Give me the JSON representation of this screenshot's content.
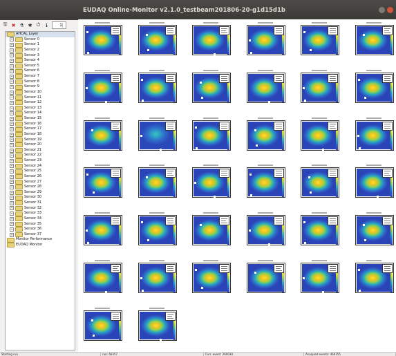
{
  "window": {
    "title": "EUDAQ Online-Monitor v2.1.0_testbeam201806-20-g1d15d1b"
  },
  "toolbar": {
    "icons": [
      "save-icon",
      "close-x-icon",
      "filter-icon",
      "broom-icon",
      "power-icon",
      "info-icon"
    ],
    "spin_value": "1"
  },
  "tree": {
    "root": "AHCAL Layer",
    "sensors": [
      "Sensor 0",
      "Sensor 1",
      "Sensor 2",
      "Sensor 3",
      "Sensor 4",
      "Sensor 5",
      "Sensor 6",
      "Sensor 7",
      "Sensor 8",
      "Sensor 9",
      "Sensor 10",
      "Sensor 11",
      "Sensor 12",
      "Sensor 13",
      "Sensor 14",
      "Sensor 15",
      "Sensor 16",
      "Sensor 17",
      "Sensor 18",
      "Sensor 19",
      "Sensor 20",
      "Sensor 21",
      "Sensor 22",
      "Sensor 23",
      "Sensor 24",
      "Sensor 25",
      "Sensor 26",
      "Sensor 27",
      "Sensor 28",
      "Sensor 29",
      "Sensor 30",
      "Sensor 31",
      "Sensor 32",
      "Sensor 33",
      "Sensor 34",
      "Sensor 35",
      "Sensor 36",
      "Sensor 37"
    ],
    "extra": [
      "Monitor Performance",
      "EUDAQ Monitor"
    ]
  },
  "canvas": {
    "histogram_count": 38,
    "cold_index": 13
  },
  "status": {
    "s1": "Starting run",
    "s2": "run: 60357",
    "s3": "Curr. event: 260030",
    "s4": "Analysed events: 460355"
  }
}
